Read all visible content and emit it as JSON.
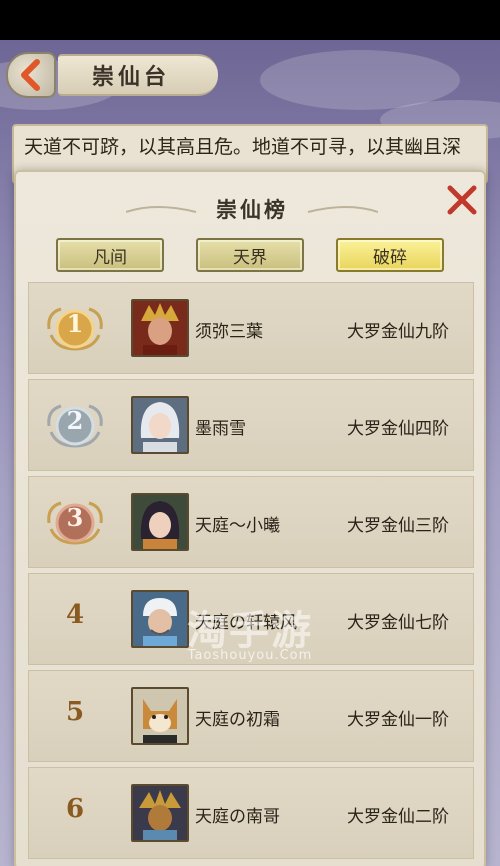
{
  "header": {
    "title": "崇仙台"
  },
  "description": {
    "text": "天道不可跻，以其高且危。地道不可寻，以其幽且深"
  },
  "dialog": {
    "title": "崇仙榜",
    "tabs": [
      {
        "label": "凡间",
        "active": false
      },
      {
        "label": "天界",
        "active": false
      },
      {
        "label": "破碎",
        "active": true
      }
    ]
  },
  "ranking": [
    {
      "rank": "1",
      "name": "须弥三葉",
      "realm": "大罗金仙九阶",
      "medal": "gold"
    },
    {
      "rank": "2",
      "name": "墨雨雪",
      "realm": "大罗金仙四阶",
      "medal": "silver"
    },
    {
      "rank": "3",
      "name": "天庭～小曦",
      "realm": "大罗金仙三阶",
      "medal": "bronze"
    },
    {
      "rank": "4",
      "name": "天庭の轩辕风",
      "realm": "大罗金仙七阶",
      "medal": "none"
    },
    {
      "rank": "5",
      "name": "天庭の初霜",
      "realm": "大罗金仙一阶",
      "medal": "none"
    },
    {
      "rank": "6",
      "name": "天庭の南哥",
      "realm": "大罗金仙二阶",
      "medal": "none"
    }
  ],
  "watermark": {
    "main": "淘手游",
    "sub": "Taoshouyou.Com"
  },
  "colors": {
    "close": "#c0392b",
    "gold_medal": "#d9a64a",
    "silver_medal": "#9aa6ae",
    "bronze_medal": "#b0705a",
    "active_tab": "#f2e37a"
  }
}
